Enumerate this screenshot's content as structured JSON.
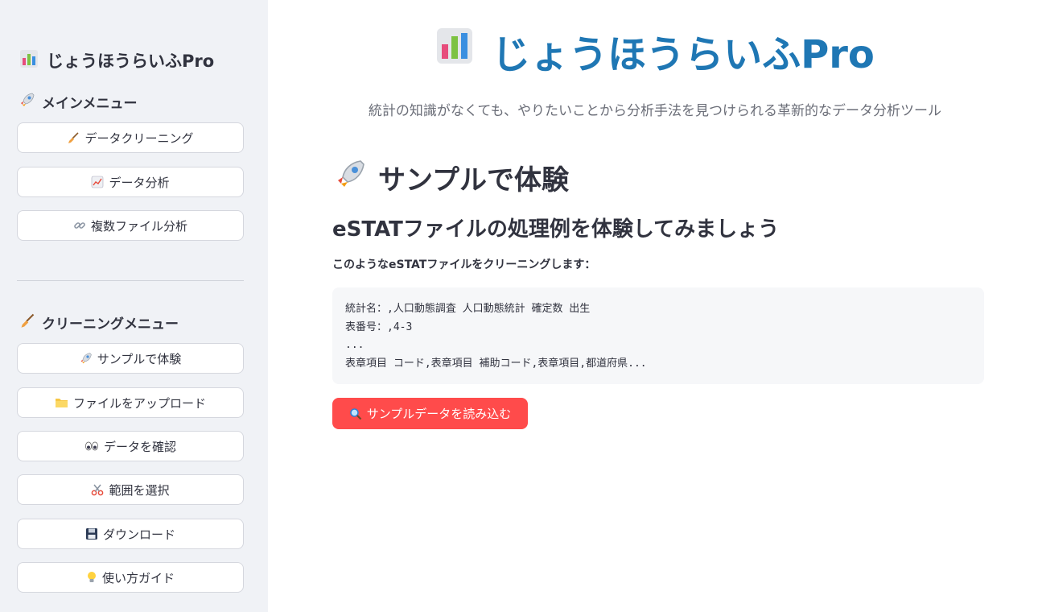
{
  "sidebar": {
    "title": "じょうほうらいふPro",
    "title_icon": "bar-chart-icon",
    "main_menu": {
      "heading": "メインメニュー",
      "icon": "rocket-icon",
      "items": [
        {
          "label": "データクリーニング",
          "icon": "broom-icon"
        },
        {
          "label": "データ分析",
          "icon": "line-chart-icon"
        },
        {
          "label": "複数ファイル分析",
          "icon": "link-icon"
        }
      ]
    },
    "cleaning_menu": {
      "heading": "クリーニングメニュー",
      "icon": "broom-icon",
      "items": [
        {
          "label": "サンプルで体験",
          "icon": "rocket-icon"
        },
        {
          "label": "ファイルをアップロード",
          "icon": "folder-icon"
        },
        {
          "label": "データを確認",
          "icon": "eyes-icon"
        },
        {
          "label": "範囲を選択",
          "icon": "scissors-icon"
        },
        {
          "label": "ダウンロード",
          "icon": "floppy-disk-icon"
        },
        {
          "label": "使い方ガイド",
          "icon": "lightbulb-icon"
        }
      ]
    }
  },
  "main": {
    "title": "じょうほうらいふPro",
    "subtitle": "統計の知識がなくても、やりたいことから分析手法を見つけられる革新的なデータ分析ツール",
    "section_heading": "サンプルで体験",
    "sub_heading": "eSTATファイルの処理例を体験してみましょう",
    "description": "このようなeSTATファイルをクリーニングします：",
    "code_lines": [
      "統計名：,人口動態調査 人口動態統計 確定数 出生",
      "表番号：,4-3",
      "...",
      "表章項目 コード,表章項目 補助コード,表章項目,都道府県..."
    ],
    "load_button": "サンプルデータを読み込む",
    "load_button_icon": "magnifier-icon"
  },
  "colors": {
    "accent_blue": "#1f77b4",
    "primary_red": "#ff4b4b",
    "sidebar_bg": "#f0f2f6"
  }
}
